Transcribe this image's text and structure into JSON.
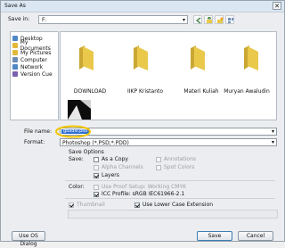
{
  "window": {
    "title": "Save As",
    "close_glyph": "✕"
  },
  "save_in": {
    "label": "Save in:",
    "value": "F:",
    "caret": "▾"
  },
  "places": [
    {
      "label": "Desktop",
      "icon": "desktop-icon",
      "color": "#4f86c6"
    },
    {
      "label": "My Documents",
      "icon": "documents-icon",
      "color": "#e2b93b"
    },
    {
      "label": "My Pictures",
      "icon": "pictures-icon",
      "color": "#e2b93b"
    },
    {
      "label": "Computer",
      "icon": "computer-icon",
      "color": "#6b8db5"
    },
    {
      "label": "Network",
      "icon": "network-icon",
      "color": "#4f86c6"
    },
    {
      "label": "Version Cue",
      "icon": "version-cue-icon",
      "color": "#7b5fb0"
    }
  ],
  "files": [
    {
      "name": "DOWNLOAD"
    },
    {
      "name": "IIKP Kristanto"
    },
    {
      "name": "Materi Kuliah"
    },
    {
      "name": "Muryan Awaludin"
    }
  ],
  "file_name": {
    "label": "File name:",
    "value": "gdxdsf.psd"
  },
  "format": {
    "label": "Format:",
    "value": "Photoshop (*.PSD;*.PDD)"
  },
  "save_options": {
    "heading": "Save Options",
    "save_label": "Save:",
    "as_copy": "As a Copy",
    "alpha_channels": "Alpha Channels",
    "layers": "Layers",
    "annotations": "Annotations",
    "spot_colors": "Spot Colors",
    "color_label": "Color:",
    "proof_setup": "Use Proof Setup:  Working CMYK",
    "icc_profile": "ICC Profile:  sRGB IEC61966-2.1",
    "thumbnail": "Thumbnail",
    "lower_case_ext": "Use Lower Case Extension"
  },
  "buttons": {
    "use_os_dialog": "Use OS Dialog",
    "save": "Save",
    "cancel": "Cancel"
  },
  "colors": {
    "folder": "#e9c84a",
    "selection": "#2f6fd1",
    "highlight_oval": "#f2c400"
  }
}
